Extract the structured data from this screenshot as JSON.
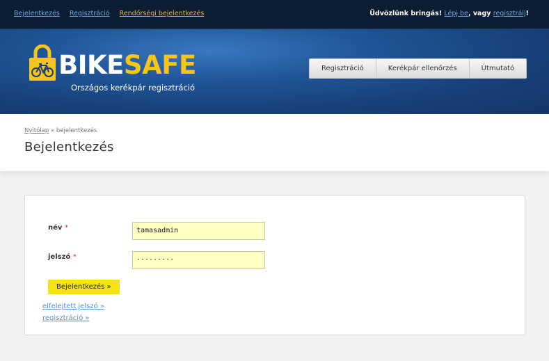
{
  "topbar": {
    "links": [
      "Bejelentkezés",
      "Regisztráció",
      "Rendőrségi bejelentkezés"
    ],
    "welcome_text": "Üdvözlünk bringás!",
    "login_link": "Lépj be",
    "separator": ", vagy",
    "register_link": "regisztrálj",
    "end_mark": "!"
  },
  "header": {
    "logo_bike": "BIKE",
    "logo_safe": "SAFE",
    "logo_subtitle": "Országos kerékpár regisztráció",
    "nav": [
      "Regisztráció",
      "Kerékpár ellenőrzés",
      "Útmutató"
    ]
  },
  "breadcrumb": {
    "home": "Nyitólap",
    "separator": "»",
    "current": "bejelentkezés"
  },
  "page": {
    "title": "Bejelentkezés"
  },
  "form": {
    "username_label": "név",
    "password_label": "jelszó",
    "required_mark": "*",
    "username_value": "tamasadmin",
    "password_value": "·········",
    "submit_label": "Bejelentkezés »",
    "forgot_link": "elfelejtett jelszó »",
    "register_link": "regisztráció »"
  },
  "colors": {
    "topbar": "#0c1d33",
    "header": "#1f5496",
    "accent": "#f5c518",
    "input_bg": "#ffffc4",
    "submit_bg": "#f5e313",
    "link": "#5a8fc2"
  },
  "icons": {
    "logo": "padlock-bicycle-icon"
  }
}
